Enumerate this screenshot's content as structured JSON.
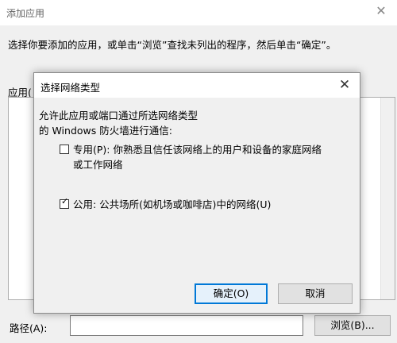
{
  "parent": {
    "title": "添加应用",
    "instructions": "选择你要添加的应用，或单击“浏览”查找未列出的程序，然后单击“确定”。",
    "apps_label": "应用(",
    "path_label": "路径(A):",
    "path_value": "",
    "browse_label": "浏览(B)..."
  },
  "modal": {
    "title": "选择网络类型",
    "description_line1": "允许此应用或端口通过所选网络类型",
    "description_line2": "的 Windows 防火墙进行通信:",
    "options": [
      {
        "label": "专用(P): 你熟悉且信任该网络上的用户和设备的家庭网络或工作网络",
        "checked": false
      },
      {
        "label": "公用: 公共场所(如机场或咖啡店)中的网络(U)",
        "checked": true
      }
    ],
    "ok_label": "确定(O)",
    "cancel_label": "取消"
  },
  "colors": {
    "accent": "#0078d7",
    "background": "#f0f0f0",
    "titlebar": "#ffffff"
  }
}
